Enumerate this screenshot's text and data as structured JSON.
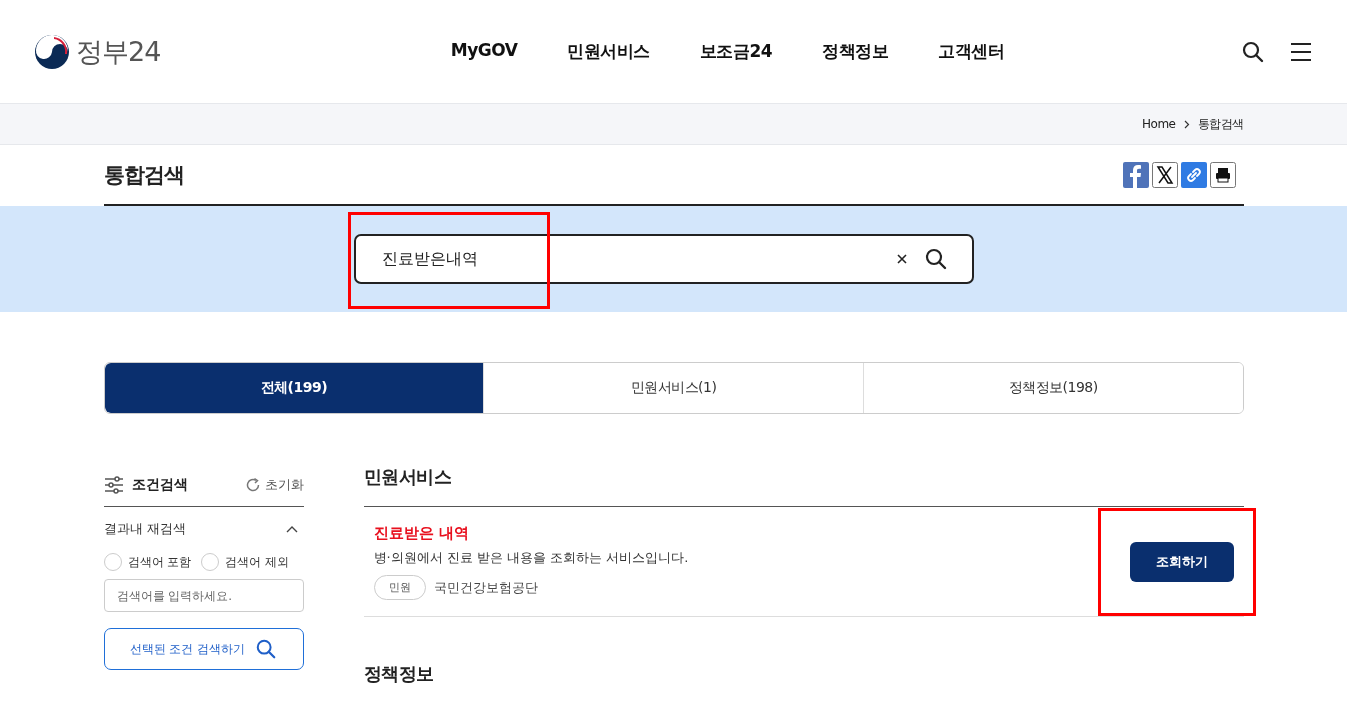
{
  "header": {
    "logo_text": "정부24",
    "nav": [
      {
        "label": "MyGOV"
      },
      {
        "label": "민원서비스"
      },
      {
        "label": "보조금24"
      },
      {
        "label": "정책정보"
      },
      {
        "label": "고객센터"
      }
    ]
  },
  "breadcrumb": [
    "Home",
    "통합검색"
  ],
  "page_title": "통합검색",
  "search": {
    "value": "진료받은내역",
    "highlighted": true
  },
  "tabs": [
    {
      "label": "전체(199)",
      "selected": true
    },
    {
      "label": "민원서비스(1)",
      "selected": false
    },
    {
      "label": "정책정보(198)",
      "selected": false
    }
  ],
  "filter": {
    "title": "조건검색",
    "reset": "초기화",
    "section": "결과내 재검색",
    "expanded": true,
    "options": [
      {
        "label": "검색어 포함",
        "selected": false
      },
      {
        "label": "검색어 제외",
        "selected": false
      }
    ],
    "placeholder": "검색어를 입력하세요.",
    "submit": "선택된 조건 검색하기"
  },
  "sections": [
    {
      "heading": "민원서비스",
      "results": [
        {
          "title": "진료받은 내역",
          "description": "병·의원에서 진료 받은 내용을 조회하는 서비스입니다.",
          "tag": "민원",
          "agency": "국민건강보험공단",
          "button": "조회하기",
          "highlighted": true
        }
      ]
    },
    {
      "heading": "정책정보"
    }
  ]
}
